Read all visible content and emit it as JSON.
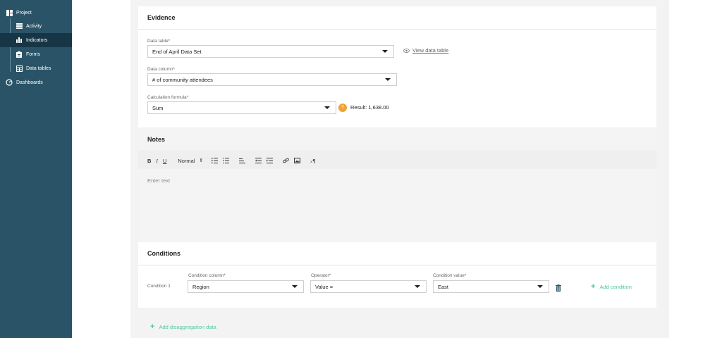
{
  "sidebar": {
    "items": [
      {
        "label": "Project",
        "icon": "grid-icon"
      },
      {
        "label": "Activity",
        "icon": "list-icon"
      },
      {
        "label": "Indicators",
        "icon": "bar-chart-icon"
      },
      {
        "label": "Forms",
        "icon": "clipboard-icon"
      },
      {
        "label": "Data tables",
        "icon": "table-icon"
      },
      {
        "label": "Dashboards",
        "icon": "gauge-icon"
      }
    ]
  },
  "evidence": {
    "title": "Evidence",
    "data_table_label": "Data table*",
    "data_table_value": "End of April Data Set",
    "view_link": "View data table",
    "data_column_label": "Data column*",
    "data_column_value": "# of community attendees",
    "formula_label": "Calculation formula*",
    "formula_value": "Sum",
    "help_badge": "?",
    "result_text": "Result: 1,638.00"
  },
  "notes": {
    "title": "Notes",
    "toolbar": {
      "bold": "B",
      "italic": "I",
      "underline": "U",
      "format": "Normal",
      "format_caret": "⇕"
    },
    "placeholder": "Enter text"
  },
  "conditions": {
    "title": "Conditions",
    "row_label": "Condition 1",
    "column_label": "Condition column*",
    "column_value": "Region",
    "operator_label": "Operator*",
    "operator_value": "Value =",
    "value_label": "Condition value*",
    "value_value": "East",
    "add_condition": "Add condition"
  },
  "footer": {
    "add_disaggregation": "Add disaggregation data"
  },
  "colors": {
    "sidebar_bg": "#2a5367",
    "sidebar_active": "#173645",
    "accent_green": "#53c79a",
    "help_orange": "#f0a233"
  }
}
